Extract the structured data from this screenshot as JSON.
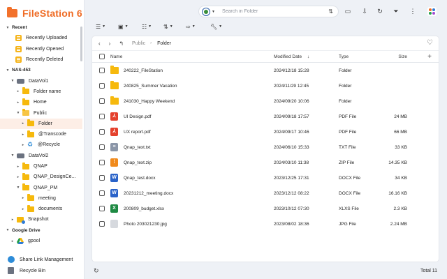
{
  "app": {
    "title": "FileStation 6"
  },
  "sidebar": {
    "recent": {
      "label": "Recent",
      "items": [
        "Recently Uploaded",
        "Recently Opened",
        "Recently Deleted"
      ]
    },
    "nas": {
      "label": "NAS-453"
    },
    "datavol1": {
      "label": "DataVol1",
      "folder_name": "Folder name",
      "home": "Home",
      "public": "Public",
      "folder": "Folder",
      "transcode": "@Transcode",
      "recycle": "@Recycle"
    },
    "datavol2": {
      "label": "DataVol2",
      "qnap": "QNAP",
      "qnap_design": "QNAP_DesignCe...",
      "qnap_pm": "QNAP_PM",
      "meeting": "meeting",
      "documents": "documents"
    },
    "snapshot": "Snapshot",
    "google_drive": {
      "label": "Google Drive",
      "item": "gpool"
    },
    "bottom": {
      "share": "Share Link Management",
      "bin": "Recycle Bin"
    }
  },
  "search": {
    "placeholder": "Search in Folder"
  },
  "breadcrumb": {
    "parent": "Public",
    "current": "Folder"
  },
  "table": {
    "headers": {
      "name": "Name",
      "date": "Modified Date",
      "type": "Type",
      "size": "Size"
    },
    "rows": [
      {
        "name": "240222_FileStation",
        "date": "2024/12/18 15:28",
        "type": "Folder",
        "size": "",
        "icon": "folder-icon"
      },
      {
        "name": "240825_Summer Vacation",
        "date": "2024/11/29 12:45",
        "type": "Folder",
        "size": "",
        "icon": "folder-icon"
      },
      {
        "name": "241030_Happy Weekend",
        "date": "2024/09/20 10:06",
        "type": "Folder",
        "size": "",
        "icon": "folder-icon"
      },
      {
        "name": "UI Design.pdf",
        "date": "2024/09/18 17:57",
        "type": "PDF File",
        "size": "24 MB",
        "icon": "pdf-icon"
      },
      {
        "name": "UX report.pdf",
        "date": "2024/09/17 10:46",
        "type": "PDF File",
        "size": "66 MB",
        "icon": "pdf-icon"
      },
      {
        "name": "Qnap_text.txt",
        "date": "2024/06/10 15:33",
        "type": "TXT File",
        "size": "33 KB",
        "icon": "txt-icon"
      },
      {
        "name": "Qnap_text.zip",
        "date": "2024/03/10 11:38",
        "type": "ZIP File",
        "size": "14.35 KB",
        "icon": "zip-icon"
      },
      {
        "name": "Qnap_test.docx",
        "date": "2023/12/25 17:31",
        "type": "DOCX File",
        "size": "34 KB",
        "icon": "docx-icon"
      },
      {
        "name": "20231212_meeting.docx",
        "date": "2023/12/12 08:22",
        "type": "DOCX File",
        "size": "16.16 KB",
        "icon": "docx-icon"
      },
      {
        "name": "200809_budget.xlsx",
        "date": "2023/10/12 07:30",
        "type": "XLXS File",
        "size": "2.3 KB",
        "icon": "xlsx-icon"
      },
      {
        "name": "Photo 203021230.jpg",
        "date": "2023/08/02 18:36",
        "type": "JPG File",
        "size": "2.24 MB",
        "icon": "jpg-icon"
      }
    ]
  },
  "footer": {
    "total": "Total 11"
  },
  "colors": {
    "accent": "#ef6b24",
    "folder": "#f6b90d",
    "selected_bg": "#fdeee6"
  }
}
